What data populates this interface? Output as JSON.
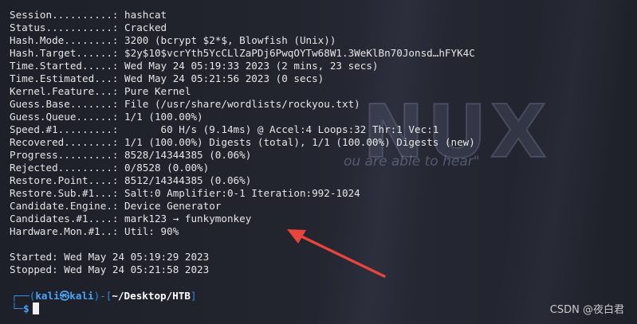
{
  "wallpaper": {
    "logo_text": "NUX",
    "tagline": "ou are able to hear\""
  },
  "output_lines": [
    "Session..........: hashcat",
    "Status...........: Cracked",
    "Hash.Mode........: 3200 (bcrypt $2*$, Blowfish (Unix))",
    "Hash.Target......: $2y$10$vcrYth5YcCLlZaPDj6PwqOYTw68W1.3WeKlBn70Jonsd…hFYK4C",
    "Time.Started.....: Wed May 24 05:19:33 2023 (2 mins, 23 secs)",
    "Time.Estimated...: Wed May 24 05:21:56 2023 (0 secs)",
    "Kernel.Feature...: Pure Kernel",
    "Guess.Base.......: File (/usr/share/wordlists/rockyou.txt)",
    "Guess.Queue......: 1/1 (100.00%)",
    "Speed.#1.........:       60 H/s (9.14ms) @ Accel:4 Loops:32 Thr:1 Vec:1",
    "Recovered........: 1/1 (100.00%) Digests (total), 1/1 (100.00%) Digests (new)",
    "Progress.........: 8528/14344385 (0.06%)",
    "Rejected.........: 0/8528 (0.00%)",
    "Restore.Point....: 8512/14344385 (0.06%)",
    "Restore.Sub.#1...: Salt:0 Amplifier:0-1 Iteration:992-1024",
    "Candidate.Engine.: Device Generator",
    "Candidates.#1....: mark123 → funkymonkey",
    "Hardware.Mon.#1..: Util: 90%",
    "",
    "Started: Wed May 24 05:19:29 2023",
    "Stopped: Wed May 24 05:21:58 2023"
  ],
  "prompt": {
    "open": "┌──(",
    "user": "kali",
    "at_icon": "kali-logo-icon",
    "at_glyph": "㉿",
    "host": "kali",
    "mid": ")-[",
    "path": "~/Desktop/HTB",
    "close": "]",
    "line2_prefix": "└─",
    "dollar": "$"
  },
  "annotation": {
    "arrow_color": "#e8453c",
    "points_to": "Candidates.#1"
  },
  "watermark": "CSDN @夜白君"
}
